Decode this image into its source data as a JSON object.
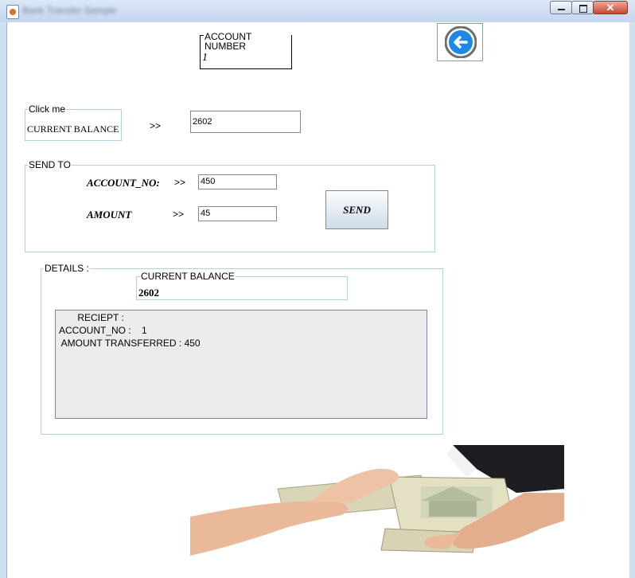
{
  "window": {
    "title": "Bank Transfer Sample",
    "controls": {
      "minimize": "_",
      "maximize": "□",
      "close": "✕"
    }
  },
  "account": {
    "caption": "ACCOUNT NUMBER",
    "value": "1"
  },
  "back_button": {
    "icon": "arrow-left-circle-icon"
  },
  "balance_panel": {
    "caption": "Click me",
    "label": "CURRENT BALANCE",
    "arrow": ">>",
    "value": "2602"
  },
  "send_to": {
    "caption": "SEND TO",
    "account_label": "ACCOUNT_NO:",
    "account_arrow": ">>",
    "account_value": "450",
    "amount_label": "AMOUNT",
    "amount_arrow": ">>",
    "amount_value": "45",
    "send_label": "SEND"
  },
  "details": {
    "caption": "DETAILS :",
    "balance_caption": "CURRENT BALANCE",
    "balance_value": "2602",
    "receipt": {
      "line1": "       RECIEPT :",
      "line2": "ACCOUNT_NO :    1",
      "line3": " AMOUNT TRANSFERRED : 450"
    }
  },
  "image": {
    "icon": "money-handover-photo"
  },
  "colors": {
    "accent": "#1e88e5",
    "group_border": "#b5cfe0",
    "receipt_bg": "#ececec"
  }
}
